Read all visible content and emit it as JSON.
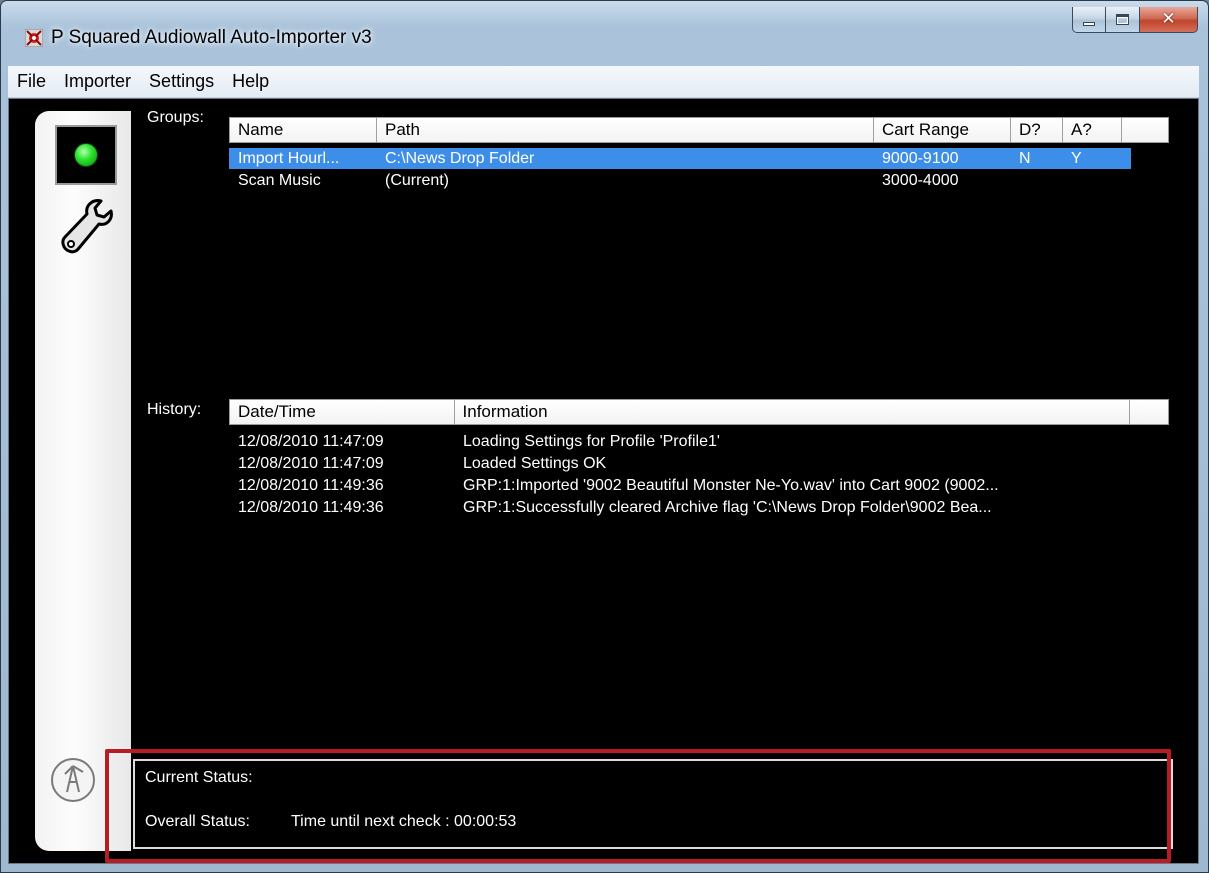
{
  "window": {
    "title": "P Squared Audiowall Auto-Importer v3"
  },
  "menu": [
    "File",
    "Importer",
    "Settings",
    "Help"
  ],
  "groups": {
    "label": "Groups:",
    "columns": [
      "Name",
      "Path",
      "Cart Range",
      "D?",
      "A?"
    ],
    "rows": [
      {
        "name": "Import Hourl...",
        "path": "C:\\News Drop Folder",
        "cart_range": "9000-9100",
        "d": "N",
        "a": "Y",
        "selected": true
      },
      {
        "name": "Scan Music",
        "path": "(Current)",
        "cart_range": "3000-4000",
        "d": "",
        "a": "",
        "selected": false
      }
    ]
  },
  "history": {
    "label": "History:",
    "columns": [
      "Date/Time",
      "Information"
    ],
    "rows": [
      {
        "datetime": "12/08/2010 11:47:09",
        "info": "Loading Settings for Profile 'Profile1'"
      },
      {
        "datetime": "12/08/2010 11:47:09",
        "info": "Loaded Settings OK"
      },
      {
        "datetime": "12/08/2010 11:49:36",
        "info": "GRP:1:Imported '9002 Beautiful Monster Ne-Yo.wav' into Cart 9002 (9002..."
      },
      {
        "datetime": "12/08/2010 11:49:36",
        "info": "GRP:1:Successfully cleared Archive flag 'C:\\News Drop Folder\\9002 Bea..."
      }
    ]
  },
  "status": {
    "current_label": "Current Status:",
    "current_value": "",
    "overall_label": "Overall Status:",
    "overall_value": "Time until next check : 00:00:53"
  },
  "colors": {
    "selection": "#3d8ee8",
    "led": "#2fe62f",
    "highlight_outline": "#b81c25"
  },
  "icons": [
    "app-icon",
    "status-led-icon",
    "wrench-icon",
    "logo-icon",
    "minimize-icon",
    "maximize-icon",
    "close-icon"
  ]
}
